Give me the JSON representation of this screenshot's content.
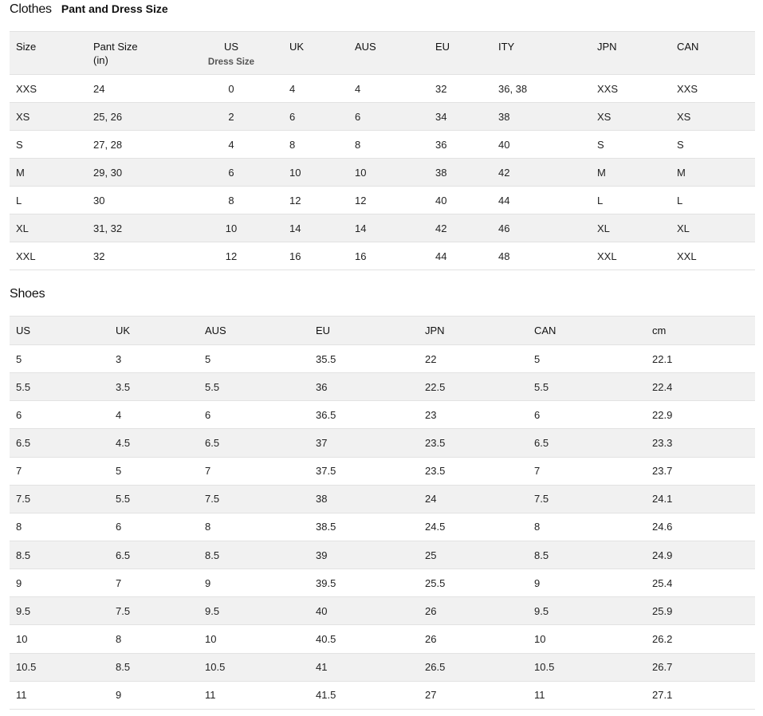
{
  "clothes": {
    "title": "Clothes",
    "subtitle": "Pant and Dress Size",
    "headers": {
      "size": "Size",
      "pant_size": "Pant Size",
      "pant_unit": "(in)",
      "us": "US",
      "us_sub": "Dress Size",
      "uk": "UK",
      "aus": "AUS",
      "eu": "EU",
      "ity": "ITY",
      "jpn": "JPN",
      "can": "CAN"
    },
    "rows": [
      [
        "XXS",
        "24",
        "0",
        "4",
        "4",
        "32",
        "36, 38",
        "XXS",
        "XXS"
      ],
      [
        "XS",
        "25, 26",
        "2",
        "6",
        "6",
        "34",
        "38",
        "XS",
        "XS"
      ],
      [
        "S",
        "27, 28",
        "4",
        "8",
        "8",
        "36",
        "40",
        "S",
        "S"
      ],
      [
        "M",
        "29, 30",
        "6",
        "10",
        "10",
        "38",
        "42",
        "M",
        "M"
      ],
      [
        "L",
        "30",
        "8",
        "12",
        "12",
        "40",
        "44",
        "L",
        "L"
      ],
      [
        "XL",
        "31, 32",
        "10",
        "14",
        "14",
        "42",
        "46",
        "XL",
        "XL"
      ],
      [
        "XXL",
        "32",
        "12",
        "16",
        "16",
        "44",
        "48",
        "XXL",
        "XXL"
      ]
    ]
  },
  "shoes": {
    "title": "Shoes",
    "headers": [
      "US",
      "UK",
      "AUS",
      "EU",
      "JPN",
      "CAN",
      "cm"
    ],
    "rows": [
      [
        "5",
        "3",
        "5",
        "35.5",
        "22",
        "5",
        "22.1"
      ],
      [
        "5.5",
        "3.5",
        "5.5",
        "36",
        "22.5",
        "5.5",
        "22.4"
      ],
      [
        "6",
        "4",
        "6",
        "36.5",
        "23",
        "6",
        "22.9"
      ],
      [
        "6.5",
        "4.5",
        "6.5",
        "37",
        "23.5",
        "6.5",
        "23.3"
      ],
      [
        "7",
        "5",
        "7",
        "37.5",
        "23.5",
        "7",
        "23.7"
      ],
      [
        "7.5",
        "5.5",
        "7.5",
        "38",
        "24",
        "7.5",
        "24.1"
      ],
      [
        "8",
        "6",
        "8",
        "38.5",
        "24.5",
        "8",
        "24.6"
      ],
      [
        "8.5",
        "6.5",
        "8.5",
        "39",
        "25",
        "8.5",
        "24.9"
      ],
      [
        "9",
        "7",
        "9",
        "39.5",
        "25.5",
        "9",
        "25.4"
      ],
      [
        "9.5",
        "7.5",
        "9.5",
        "40",
        "26",
        "9.5",
        "25.9"
      ],
      [
        "10",
        "8",
        "10",
        "40.5",
        "26",
        "10",
        "26.2"
      ],
      [
        "10.5",
        "8.5",
        "10.5",
        "41",
        "26.5",
        "10.5",
        "26.7"
      ],
      [
        "11",
        "9",
        "11",
        "41.5",
        "27",
        "11",
        "27.1"
      ]
    ]
  }
}
